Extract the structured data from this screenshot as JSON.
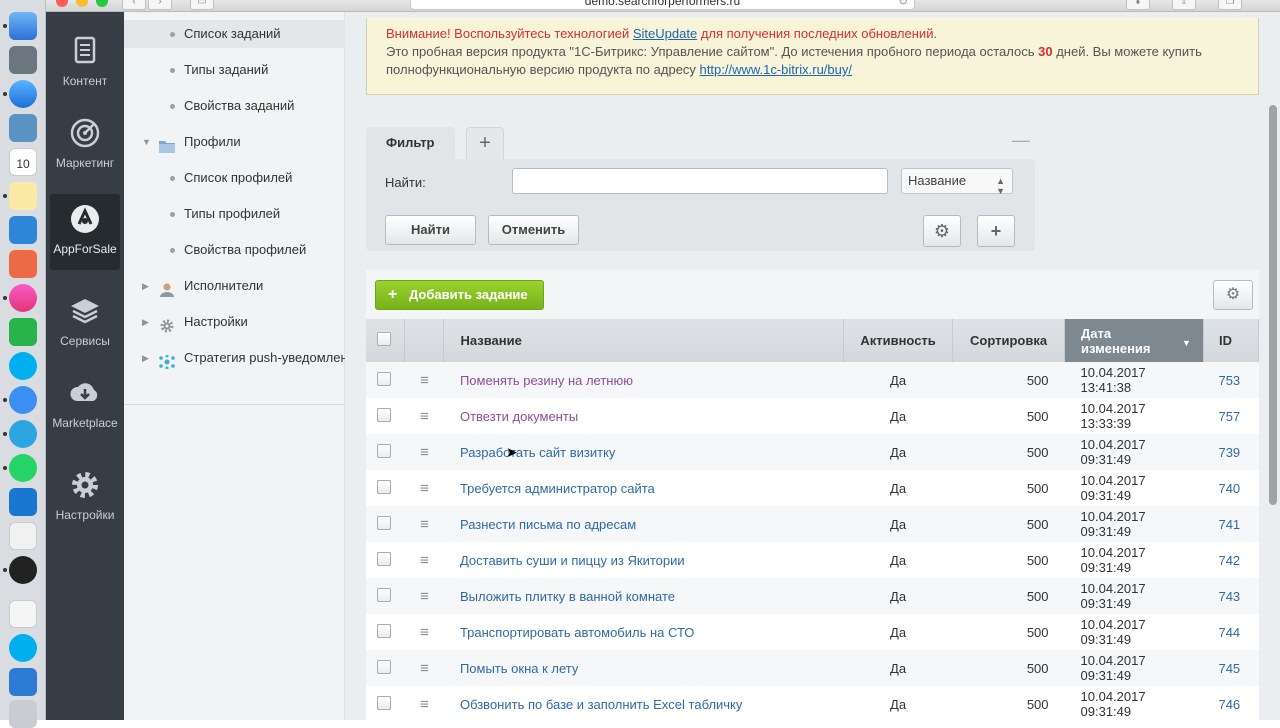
{
  "browser": {
    "url": "demo.searchforperformers.ru"
  },
  "leftnav": {
    "items": [
      {
        "label": "Контент",
        "icon": "document-icon"
      },
      {
        "label": "Маркетинг",
        "icon": "target-icon"
      },
      {
        "label": "AppForSale",
        "icon": "appforsale-icon",
        "active": true
      },
      {
        "label": "Сервисы",
        "icon": "layers-icon"
      },
      {
        "label": "Marketplace",
        "icon": "cloud-download-icon"
      },
      {
        "label": "Настройки",
        "icon": "gear-icon"
      }
    ]
  },
  "tree": {
    "items": [
      {
        "label": "Список заданий",
        "type": "leaf",
        "selected": true
      },
      {
        "label": "Типы заданий",
        "type": "leaf"
      },
      {
        "label": "Свойства заданий",
        "type": "leaf"
      },
      {
        "label": "Профили",
        "type": "folder-open",
        "icon": "folder-icon"
      },
      {
        "label": "Список профилей",
        "type": "leaf"
      },
      {
        "label": "Типы профилей",
        "type": "leaf"
      },
      {
        "label": "Свойства профилей",
        "type": "leaf"
      },
      {
        "label": "Исполнители",
        "type": "folder",
        "icon": "user-icon"
      },
      {
        "label": "Настройки",
        "type": "folder",
        "icon": "gear-icon"
      },
      {
        "label": "Стратегия push-уведомлений",
        "type": "folder",
        "icon": "network-icon"
      }
    ]
  },
  "notice": {
    "warn_prefix": "Внимание! Воспользуйтесь технологией ",
    "warn_link": "SiteUpdate",
    "warn_suffix": " для получения последних обновлений.",
    "text_1": "Это пробная версия продукта \"1С-Битрикс: Управление сайтом\". До истечения пробного периода осталось ",
    "days": "30",
    "text_2": " дней. Вы можете купить полнофункциональную версию продукта по адресу ",
    "buy_link": "http://www.1c-bitrix.ru/buy/"
  },
  "filter": {
    "tab_label": "Фильтр",
    "find_label": "Найти:",
    "find_value": "",
    "field_select": "Название",
    "find_button": "Найти",
    "cancel_button": "Отменить"
  },
  "list": {
    "add_button": "Добавить задание",
    "columns": [
      "Название",
      "Активность",
      "Сортировка",
      "Дата изменения",
      "ID"
    ],
    "sorted_column": "Дата изменения",
    "rows": [
      {
        "name": "Поменять резину на летнюю",
        "active": "Да",
        "sort": "500",
        "date": "10.04.2017 13:41:38",
        "id": "753",
        "visited": true
      },
      {
        "name": "Отвезти документы",
        "active": "Да",
        "sort": "500",
        "date": "10.04.2017 13:33:39",
        "id": "757",
        "visited": true
      },
      {
        "name": "Разработать сайт визитку",
        "active": "Да",
        "sort": "500",
        "date": "10.04.2017 09:31:49",
        "id": "739"
      },
      {
        "name": "Требуется администратор сайта",
        "active": "Да",
        "sort": "500",
        "date": "10.04.2017 09:31:49",
        "id": "740"
      },
      {
        "name": "Разнести письма по адресам",
        "active": "Да",
        "sort": "500",
        "date": "10.04.2017 09:31:49",
        "id": "741"
      },
      {
        "name": "Доставить суши и пиццу из Якитории",
        "active": "Да",
        "sort": "500",
        "date": "10.04.2017 09:31:49",
        "id": "742"
      },
      {
        "name": "Выложить плитку в ванной комнате",
        "active": "Да",
        "sort": "500",
        "date": "10.04.2017 09:31:49",
        "id": "743"
      },
      {
        "name": "Транспортировать автомобиль на СТО",
        "active": "Да",
        "sort": "500",
        "date": "10.04.2017 09:31:49",
        "id": "744"
      },
      {
        "name": "Помыть окна к лету",
        "active": "Да",
        "sort": "500",
        "date": "10.04.2017 09:31:49",
        "id": "745"
      },
      {
        "name": "Обзвонить по базе и заполнить Excel табличку",
        "active": "Да",
        "sort": "500",
        "date": "10.04.2017 09:31:49",
        "id": "746"
      }
    ]
  },
  "colors": {
    "accent_green": "#80bb23",
    "link": "#2f6aa8",
    "visited": "#8e4d9c",
    "warn": "#d9302c"
  }
}
